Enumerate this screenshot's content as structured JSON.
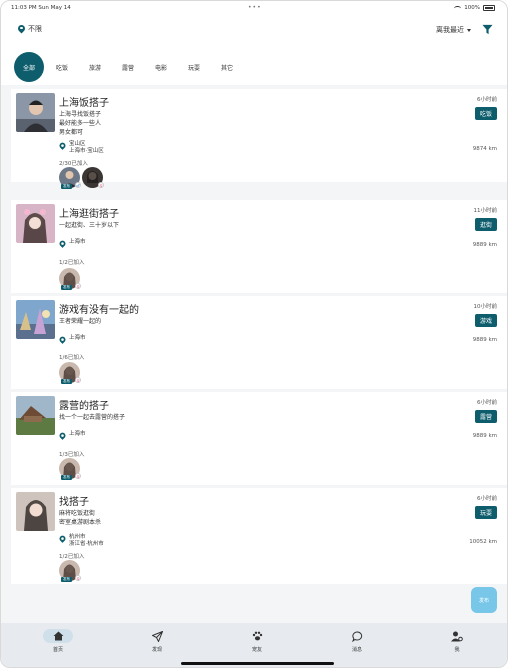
{
  "status_bar": {
    "time": "11:03 PM   Sun May 14",
    "dots": "•••",
    "battery": "100%"
  },
  "header": {
    "location": "不限",
    "sort": "离我最近"
  },
  "categories": [
    {
      "label": "全部",
      "active": true
    },
    {
      "label": "吃饭"
    },
    {
      "label": "旅游"
    },
    {
      "label": "露营"
    },
    {
      "label": "电影"
    },
    {
      "label": "玩耍"
    },
    {
      "label": "其它"
    }
  ],
  "posts": [
    {
      "title": "上海饭搭子",
      "desc": [
        "上海寻找饭搭子",
        "最好能多一些人",
        "男女都可"
      ],
      "address": [
        "宝山区",
        "上海市·宝山区"
      ],
      "joined": "2/30已加入",
      "time_ago": "6小时前",
      "category": "吃饭",
      "distance": "9874 km",
      "avatar_tag": "发布"
    },
    {
      "title": "上海逛街搭子",
      "desc": [
        "一起逛街、三十岁以下"
      ],
      "address": [
        "上海市"
      ],
      "joined": "1/2已加入",
      "time_ago": "11小时前",
      "category": "逛街",
      "distance": "9889 km",
      "avatar_tag": "发布"
    },
    {
      "title": "游戏有没有一起的",
      "desc": [
        "王者荣耀一起的"
      ],
      "address": [
        "上海市"
      ],
      "joined": "1/6已加入",
      "time_ago": "10小时前",
      "category": "游戏",
      "distance": "9889 km",
      "avatar_tag": "发布"
    },
    {
      "title": "露营的搭子",
      "desc": [
        "找一个一起去露营的搭子"
      ],
      "address": [
        "上海市"
      ],
      "joined": "1/3已加入",
      "time_ago": "6小时前",
      "category": "露营",
      "distance": "9889 km",
      "avatar_tag": "发布"
    },
    {
      "title": "找搭子",
      "desc": [
        "麻将吃饭逛街",
        "密室桌游剧本杀"
      ],
      "address": [
        "杭州市",
        "浙江省·杭州市"
      ],
      "joined": "1/2已加入",
      "time_ago": "6小时前",
      "category": "玩耍",
      "distance": "10052 km",
      "avatar_tag": "发布"
    }
  ],
  "fab": {
    "label": "发布"
  },
  "tabbar": [
    {
      "label": "首页",
      "icon": "home-icon",
      "active": true
    },
    {
      "label": "发现",
      "icon": "send-icon"
    },
    {
      "label": "宠友",
      "icon": "paw-icon"
    },
    {
      "label": "消息",
      "icon": "message-icon"
    },
    {
      "label": "我",
      "icon": "user-settings-icon"
    }
  ],
  "colors": {
    "accent": "#0d5d6d",
    "fab": "#78c7e9",
    "tabbar": "#e7ebef"
  }
}
